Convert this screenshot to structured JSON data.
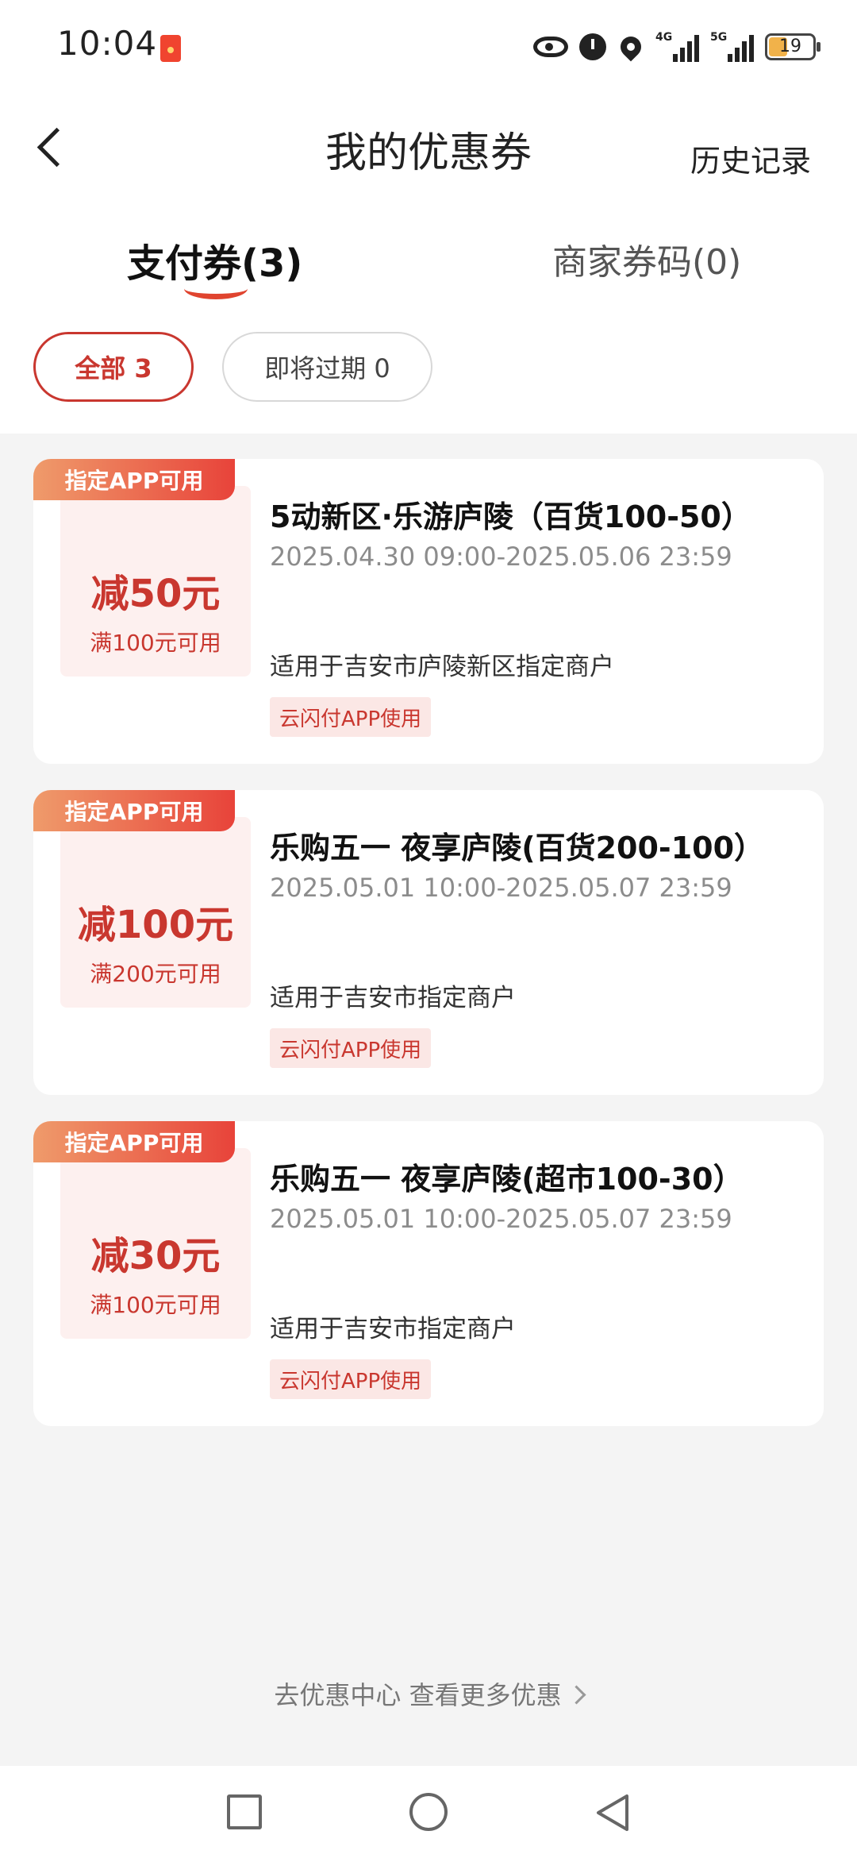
{
  "status": {
    "time": "10:04",
    "battery": "19",
    "net1": "4G",
    "net2": "5G"
  },
  "header": {
    "title": "我的优惠券",
    "history": "历史记录"
  },
  "tabs": [
    {
      "label": "支付券(3)"
    },
    {
      "label": "商家券码(0)"
    }
  ],
  "filters": [
    {
      "label": "全部 3"
    },
    {
      "label": "即将过期 0"
    }
  ],
  "coupons": [
    {
      "badge": "指定APP可用",
      "amount": "减50元",
      "condition": "满100元可用",
      "title": "5动新区·乐游庐陵（百货100-50）",
      "date": "2025.04.30 09:00-2025.05.06 23:59",
      "scope": "适用于吉安市庐陵新区指定商户",
      "tag": "云闪付APP使用"
    },
    {
      "badge": "指定APP可用",
      "amount": "减100元",
      "condition": "满200元可用",
      "title": "乐购五一 夜享庐陵(百货200-100）",
      "date": "2025.05.01 10:00-2025.05.07 23:59",
      "scope": "适用于吉安市指定商户",
      "tag": "云闪付APP使用"
    },
    {
      "badge": "指定APP可用",
      "amount": "减30元",
      "condition": "满100元可用",
      "title": "乐购五一 夜享庐陵(超市100-30）",
      "date": "2025.05.01 10:00-2025.05.07 23:59",
      "scope": "适用于吉安市指定商户",
      "tag": "云闪付APP使用"
    }
  ],
  "footer": {
    "link": "去优惠中心 查看更多优惠"
  },
  "colors": {
    "accent": "#c9372f",
    "badge_from": "#ef9b6b",
    "badge_to": "#e8433a"
  }
}
